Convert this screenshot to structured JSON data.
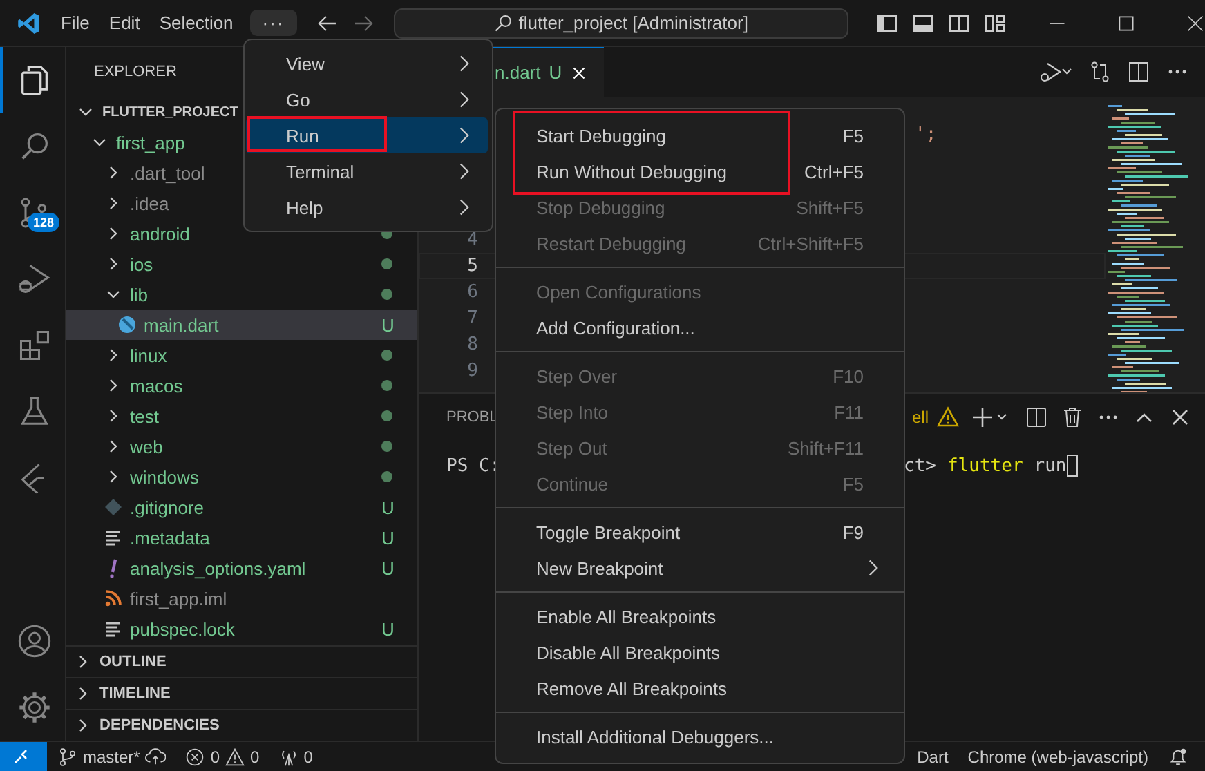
{
  "title_bar": {
    "menus": [
      {
        "label": "File"
      },
      {
        "label": "Edit"
      },
      {
        "label": "Selection"
      }
    ],
    "overflow": {
      "label": "···",
      "open": true
    },
    "command_center": "flutter_project [Administrator]"
  },
  "activity_bar": {
    "items": [
      {
        "kind": "explorer",
        "selected": true
      },
      {
        "kind": "search",
        "selected": false
      },
      {
        "kind": "source-control",
        "selected": false,
        "badge": "128"
      },
      {
        "kind": "run-debug",
        "selected": false
      },
      {
        "kind": "extensions",
        "selected": false
      },
      {
        "kind": "testing",
        "selected": false
      },
      {
        "kind": "flutter",
        "selected": false
      }
    ],
    "bottom": [
      {
        "kind": "account"
      },
      {
        "kind": "settings"
      }
    ]
  },
  "sidebar": {
    "title": "EXPLORER",
    "tree": [
      {
        "label": "FLUTTER_PROJECT",
        "kind": "root",
        "expanded": true,
        "children": [
          {
            "label": "first_app",
            "kind": "folder",
            "expanded": true,
            "ignored": false,
            "dot": false,
            "selected": false,
            "children": [
              {
                "label": ".dart_tool",
                "kind": "folder",
                "expanded": false,
                "ignored": true,
                "dot": false,
                "selected": false
              },
              {
                "label": ".idea",
                "kind": "folder",
                "expanded": false,
                "ignored": true,
                "dot": false,
                "selected": false
              },
              {
                "label": "android",
                "kind": "folder",
                "expanded": false,
                "ignored": false,
                "dot": true,
                "selected": false
              },
              {
                "label": "ios",
                "kind": "folder",
                "expanded": false,
                "ignored": false,
                "dot": true,
                "selected": false
              },
              {
                "label": "lib",
                "kind": "folder",
                "expanded": true,
                "ignored": false,
                "dot": true,
                "selected": false,
                "children": [
                  {
                    "label": "main.dart",
                    "kind": "dart",
                    "ignored": false,
                    "dot": false,
                    "selected": true,
                    "badge": "U"
                  }
                ]
              },
              {
                "label": "linux",
                "kind": "folder",
                "expanded": false,
                "ignored": false,
                "dot": true,
                "selected": false
              },
              {
                "label": "macos",
                "kind": "folder",
                "expanded": false,
                "ignored": false,
                "dot": true,
                "selected": false
              },
              {
                "label": "test",
                "kind": "folder",
                "expanded": false,
                "ignored": false,
                "dot": true,
                "selected": false
              },
              {
                "label": "web",
                "kind": "folder",
                "expanded": false,
                "ignored": false,
                "dot": true,
                "selected": false
              },
              {
                "label": "windows",
                "kind": "folder",
                "expanded": false,
                "ignored": false,
                "dot": true,
                "selected": false
              },
              {
                "label": ".gitignore",
                "kind": "git",
                "ignored": false,
                "dot": false,
                "selected": false,
                "badge": "U"
              },
              {
                "label": ".metadata",
                "kind": "lines",
                "ignored": false,
                "dot": false,
                "selected": false,
                "badge": "U"
              },
              {
                "label": "analysis_options.yaml",
                "kind": "yaml",
                "ignored": false,
                "dot": false,
                "selected": false,
                "badge": "U"
              },
              {
                "label": "first_app.iml",
                "kind": "rss",
                "ignored": true,
                "dot": false,
                "selected": false
              },
              {
                "label": "pubspec.lock",
                "kind": "lines",
                "ignored": false,
                "dot": false,
                "selected": false,
                "badge": "U"
              }
            ]
          }
        ]
      }
    ],
    "sections": [
      {
        "label": "OUTLINE",
        "expanded": false
      },
      {
        "label": "TIMELINE",
        "expanded": false
      },
      {
        "label": "DEPENDENCIES",
        "expanded": false
      }
    ]
  },
  "editor": {
    "tab": {
      "label": "n.dart",
      "badge": "U"
    },
    "code_fragment": "';",
    "line_numbers": [
      {
        "n": "4",
        "current": false
      },
      {
        "n": "5",
        "current": true
      },
      {
        "n": "6",
        "current": false
      },
      {
        "n": "7",
        "current": false
      },
      {
        "n": "8",
        "current": false
      },
      {
        "n": "9",
        "current": false
      }
    ]
  },
  "panel": {
    "tab": "PROBL",
    "shell_label": "ell",
    "terminal": {
      "prompt_start": "PS C:",
      "prompt_end": "ct>",
      "command": "flutter",
      "args": "run"
    }
  },
  "overflow_menu": {
    "items": [
      {
        "label": "View",
        "selected": false,
        "annotated": false
      },
      {
        "label": "Go",
        "selected": false,
        "annotated": false
      },
      {
        "label": "Run",
        "selected": true,
        "annotated": true
      },
      {
        "label": "Terminal",
        "selected": false,
        "annotated": false
      },
      {
        "label": "Help",
        "selected": false,
        "annotated": false
      }
    ]
  },
  "run_menu": {
    "groups": [
      {
        "items": [
          {
            "label": "Start Debugging",
            "shortcut": "F5",
            "disabled": false,
            "annotated": true,
            "submenu": false
          },
          {
            "label": "Run Without Debugging",
            "shortcut": "Ctrl+F5",
            "disabled": false,
            "annotated": true,
            "submenu": false
          },
          {
            "label": "Stop Debugging",
            "shortcut": "Shift+F5",
            "disabled": true,
            "annotated": false,
            "submenu": false
          },
          {
            "label": "Restart Debugging",
            "shortcut": "Ctrl+Shift+F5",
            "disabled": true,
            "annotated": false,
            "submenu": false
          }
        ]
      },
      {
        "items": [
          {
            "label": "Open Configurations",
            "disabled": true,
            "annotated": false,
            "submenu": false
          },
          {
            "label": "Add Configuration...",
            "disabled": false,
            "annotated": false,
            "submenu": false
          }
        ]
      },
      {
        "items": [
          {
            "label": "Step Over",
            "shortcut": "F10",
            "disabled": true,
            "annotated": false,
            "submenu": false
          },
          {
            "label": "Step Into",
            "shortcut": "F11",
            "disabled": true,
            "annotated": false,
            "submenu": false
          },
          {
            "label": "Step Out",
            "shortcut": "Shift+F11",
            "disabled": true,
            "annotated": false,
            "submenu": false
          },
          {
            "label": "Continue",
            "shortcut": "F5",
            "disabled": true,
            "annotated": false,
            "submenu": false
          }
        ]
      },
      {
        "items": [
          {
            "label": "Toggle Breakpoint",
            "shortcut": "F9",
            "disabled": false,
            "annotated": false,
            "submenu": false
          },
          {
            "label": "New Breakpoint",
            "disabled": false,
            "annotated": false,
            "submenu": true
          }
        ]
      },
      {
        "items": [
          {
            "label": "Enable All Breakpoints",
            "disabled": false,
            "annotated": false,
            "submenu": false
          },
          {
            "label": "Disable All Breakpoints",
            "disabled": false,
            "annotated": false,
            "submenu": false
          },
          {
            "label": "Remove All Breakpoints",
            "disabled": false,
            "annotated": false,
            "submenu": false
          }
        ]
      },
      {
        "items": [
          {
            "label": "Install Additional Debuggers...",
            "disabled": false,
            "annotated": false,
            "submenu": false
          }
        ]
      }
    ]
  },
  "status_bar": {
    "branch": "master*",
    "errors": "0",
    "warnings": "0",
    "ports": "0",
    "language": "Dart",
    "debug_target": "Chrome (web-javascript)"
  }
}
